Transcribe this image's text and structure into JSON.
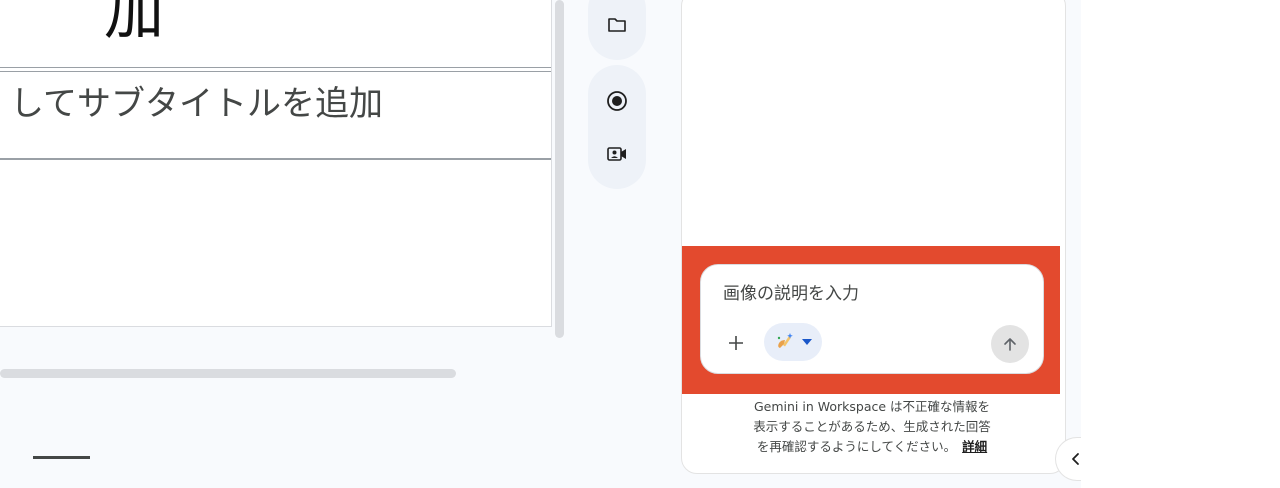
{
  "slide": {
    "title_fragment": "加",
    "subtitle_fragment": "してサブタイトルを追加"
  },
  "rail": {
    "icons": [
      "folder-icon",
      "record-icon",
      "camera-video-icon"
    ]
  },
  "panel": {
    "prompt": {
      "placeholder": "画像の説明を入力",
      "value": ""
    },
    "style_chip_icon": "image-style-icon",
    "disclaimer_lines": [
      "Gemini in Workspace は不正確な情報を",
      "表示することがあるため、生成された回答",
      "を再確認するようにしてください。"
    ],
    "learn_more": "詳細"
  },
  "colors": {
    "highlight": "#e34a2e",
    "accent_blue": "#1a57c9",
    "rail_bg": "#eef2f8"
  }
}
